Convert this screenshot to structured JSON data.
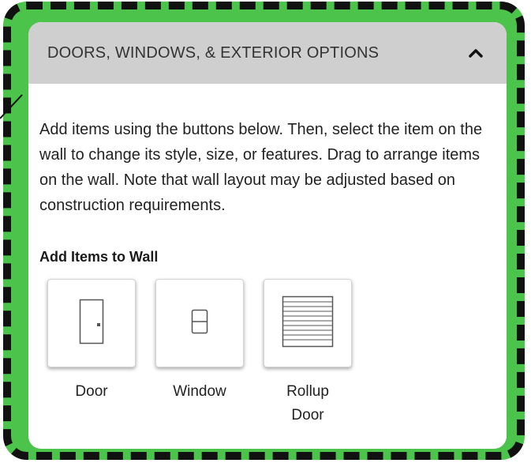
{
  "panel": {
    "title": "DOORS, WINDOWS, & EXTERIOR OPTIONS",
    "collapse_icon": "chevron-up-icon",
    "description": "Add items using the buttons below. Then, select the item on the wall to change its style, size, or features. Drag to arrange items on the wall. Note that wall layout may be adjusted based on construction requirements.",
    "section_label": "Add Items to Wall",
    "items": [
      {
        "label": "Door",
        "icon": "door-icon"
      },
      {
        "label": "Window",
        "icon": "window-icon"
      },
      {
        "label": "Rollup\nDoor",
        "icon": "rollup-door-icon"
      }
    ]
  },
  "colors": {
    "highlight_frame": "#4cc34a",
    "frame_dash": "#111111",
    "header_bg": "#cfcfcf"
  }
}
